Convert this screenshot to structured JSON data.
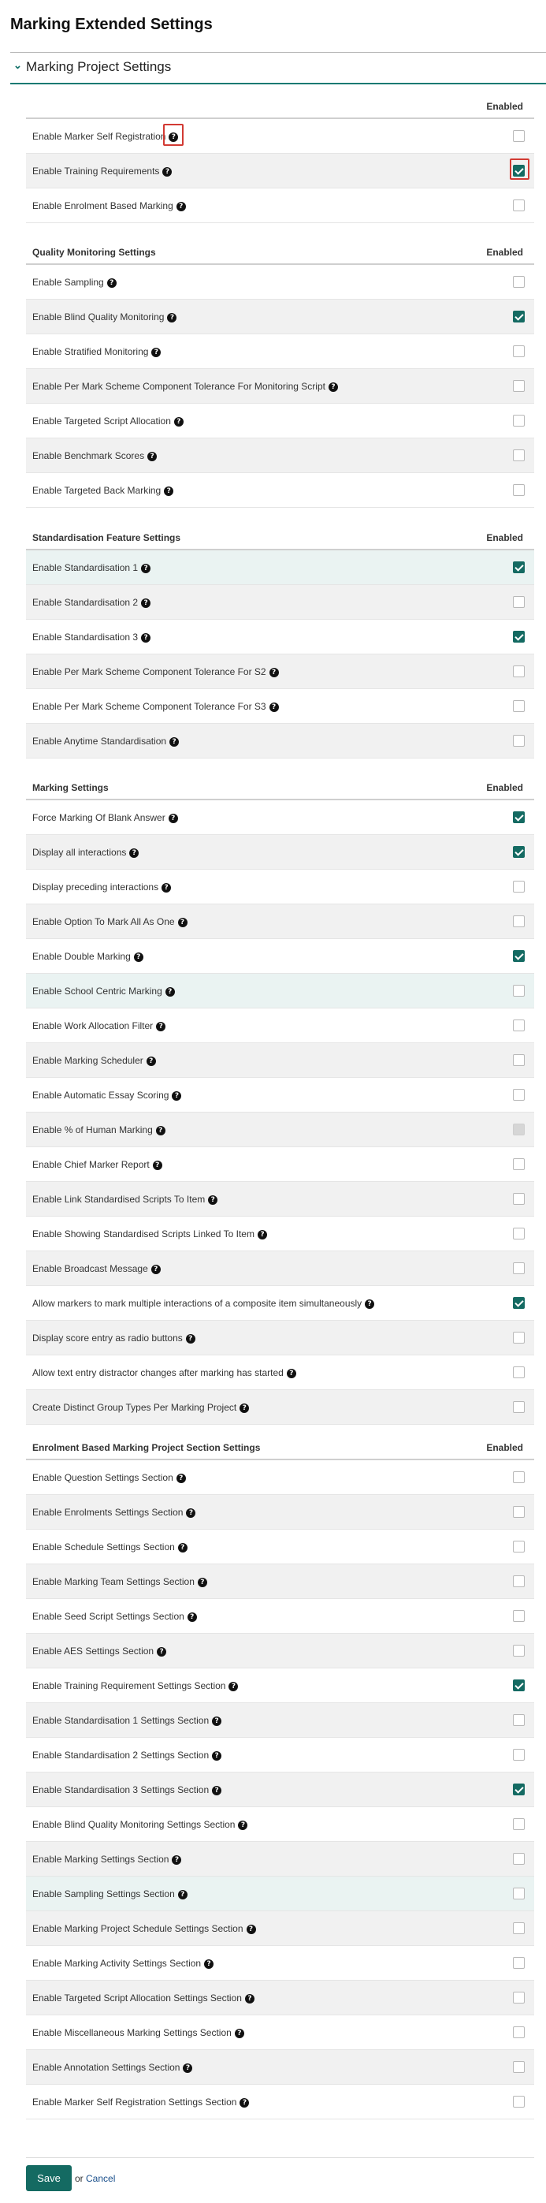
{
  "page": {
    "title": "Marking Extended Settings",
    "section_title": "Marking Project Settings",
    "chevron_icon": "chevron-down-icon",
    "help_icon": "question-circle-icon"
  },
  "groups": [
    {
      "title": "",
      "enabled_label": "Enabled",
      "rows": [
        {
          "label": "Enable Marker Self Registration",
          "checked": false,
          "disabled": false,
          "bg": "white"
        },
        {
          "label": "Enable Training Requirements",
          "checked": true,
          "disabled": false,
          "bg": "shade"
        },
        {
          "label": "Enable Enrolment Based Marking",
          "checked": false,
          "disabled": false,
          "bg": "white"
        }
      ]
    },
    {
      "title": "Quality Monitoring Settings",
      "enabled_label": "Enabled",
      "rows": [
        {
          "label": "Enable Sampling",
          "checked": false,
          "disabled": false,
          "bg": "white"
        },
        {
          "label": "Enable Blind Quality Monitoring",
          "checked": true,
          "disabled": false,
          "bg": "shade"
        },
        {
          "label": "Enable Stratified Monitoring",
          "checked": false,
          "disabled": false,
          "bg": "white"
        },
        {
          "label": "Enable Per Mark Scheme Component Tolerance For Monitoring Script",
          "checked": false,
          "disabled": false,
          "bg": "shade"
        },
        {
          "label": "Enable Targeted Script Allocation",
          "checked": false,
          "disabled": false,
          "bg": "white"
        },
        {
          "label": "Enable Benchmark Scores",
          "checked": false,
          "disabled": false,
          "bg": "shade"
        },
        {
          "label": "Enable Targeted Back Marking",
          "checked": false,
          "disabled": false,
          "bg": "white"
        }
      ]
    },
    {
      "title": "Standardisation Feature Settings",
      "enabled_label": "Enabled",
      "rows": [
        {
          "label": "Enable Standardisation 1",
          "checked": true,
          "disabled": false,
          "bg": "tint"
        },
        {
          "label": "Enable Standardisation 2",
          "checked": false,
          "disabled": false,
          "bg": "shade"
        },
        {
          "label": "Enable Standardisation 3",
          "checked": true,
          "disabled": false,
          "bg": "white"
        },
        {
          "label": "Enable Per Mark Scheme Component Tolerance For S2",
          "checked": false,
          "disabled": false,
          "bg": "shade"
        },
        {
          "label": "Enable Per Mark Scheme Component Tolerance For S3",
          "checked": false,
          "disabled": false,
          "bg": "white"
        },
        {
          "label": "Enable Anytime Standardisation",
          "checked": false,
          "disabled": false,
          "bg": "shade"
        }
      ]
    },
    {
      "title": "Marking Settings",
      "enabled_label": "Enabled",
      "rows": [
        {
          "label": "Force Marking Of Blank Answer",
          "checked": true,
          "disabled": false,
          "bg": "white"
        },
        {
          "label": "Display all interactions",
          "checked": true,
          "disabled": false,
          "bg": "shade"
        },
        {
          "label": "Display preceding interactions",
          "checked": false,
          "disabled": false,
          "bg": "white"
        },
        {
          "label": "Enable Option To Mark All As One",
          "checked": false,
          "disabled": false,
          "bg": "shade"
        },
        {
          "label": "Enable Double Marking",
          "checked": true,
          "disabled": false,
          "bg": "white"
        },
        {
          "label": "Enable School Centric Marking",
          "checked": false,
          "disabled": false,
          "bg": "tint"
        },
        {
          "label": "Enable Work Allocation Filter",
          "checked": false,
          "disabled": false,
          "bg": "white"
        },
        {
          "label": "Enable Marking Scheduler",
          "checked": false,
          "disabled": false,
          "bg": "shade"
        },
        {
          "label": "Enable Automatic Essay Scoring",
          "checked": false,
          "disabled": false,
          "bg": "white"
        },
        {
          "label": "Enable % of Human Marking",
          "checked": false,
          "disabled": true,
          "bg": "shade"
        },
        {
          "label": "Enable Chief Marker Report",
          "checked": false,
          "disabled": false,
          "bg": "white"
        },
        {
          "label": "Enable Link Standardised Scripts To Item",
          "checked": false,
          "disabled": false,
          "bg": "shade"
        },
        {
          "label": "Enable Showing Standardised Scripts Linked To Item",
          "checked": false,
          "disabled": false,
          "bg": "white"
        },
        {
          "label": "Enable Broadcast Message",
          "checked": false,
          "disabled": false,
          "bg": "shade"
        },
        {
          "label": "Allow markers to mark multiple interactions of a composite item simultaneously",
          "checked": true,
          "disabled": false,
          "bg": "white"
        },
        {
          "label": "Display score entry as radio buttons",
          "checked": false,
          "disabled": false,
          "bg": "shade"
        },
        {
          "label": "Allow text entry distractor changes after marking has started",
          "checked": false,
          "disabled": false,
          "bg": "white"
        },
        {
          "label": "Create Distinct Group Types Per Marking Project",
          "checked": false,
          "disabled": false,
          "bg": "shade"
        }
      ]
    },
    {
      "title": "Enrolment Based Marking Project Section Settings",
      "enabled_label": "Enabled",
      "rows": [
        {
          "label": "Enable Question Settings Section",
          "checked": false,
          "disabled": false,
          "bg": "white"
        },
        {
          "label": "Enable Enrolments Settings Section",
          "checked": false,
          "disabled": false,
          "bg": "shade"
        },
        {
          "label": "Enable Schedule Settings Section",
          "checked": false,
          "disabled": false,
          "bg": "white"
        },
        {
          "label": "Enable Marking Team Settings Section",
          "checked": false,
          "disabled": false,
          "bg": "shade"
        },
        {
          "label": "Enable Seed Script Settings Section",
          "checked": false,
          "disabled": false,
          "bg": "white"
        },
        {
          "label": "Enable AES Settings Section",
          "checked": false,
          "disabled": false,
          "bg": "shade"
        },
        {
          "label": "Enable Training Requirement Settings Section",
          "checked": true,
          "disabled": false,
          "bg": "white"
        },
        {
          "label": "Enable Standardisation 1 Settings Section",
          "checked": false,
          "disabled": false,
          "bg": "shade"
        },
        {
          "label": "Enable Standardisation 2 Settings Section",
          "checked": false,
          "disabled": false,
          "bg": "white"
        },
        {
          "label": "Enable Standardisation 3 Settings Section",
          "checked": true,
          "disabled": false,
          "bg": "shade"
        },
        {
          "label": "Enable Blind Quality Monitoring Settings Section",
          "checked": false,
          "disabled": false,
          "bg": "white"
        },
        {
          "label": "Enable Marking Settings Section",
          "checked": false,
          "disabled": false,
          "bg": "shade"
        },
        {
          "label": "Enable Sampling Settings Section",
          "checked": false,
          "disabled": false,
          "bg": "tint"
        },
        {
          "label": "Enable Marking Project Schedule Settings Section",
          "checked": false,
          "disabled": false,
          "bg": "shade"
        },
        {
          "label": "Enable Marking Activity Settings Section",
          "checked": false,
          "disabled": false,
          "bg": "white"
        },
        {
          "label": "Enable Targeted Script Allocation Settings Section",
          "checked": false,
          "disabled": false,
          "bg": "shade"
        },
        {
          "label": "Enable Miscellaneous Marking Settings Section",
          "checked": false,
          "disabled": false,
          "bg": "white"
        },
        {
          "label": "Enable Annotation Settings Section",
          "checked": false,
          "disabled": false,
          "bg": "shade"
        },
        {
          "label": "Enable Marker Self Registration Settings Section",
          "checked": false,
          "disabled": false,
          "bg": "white"
        }
      ]
    }
  ],
  "footer": {
    "save_label": "Save",
    "or_label": "or",
    "cancel_label": "Cancel"
  }
}
